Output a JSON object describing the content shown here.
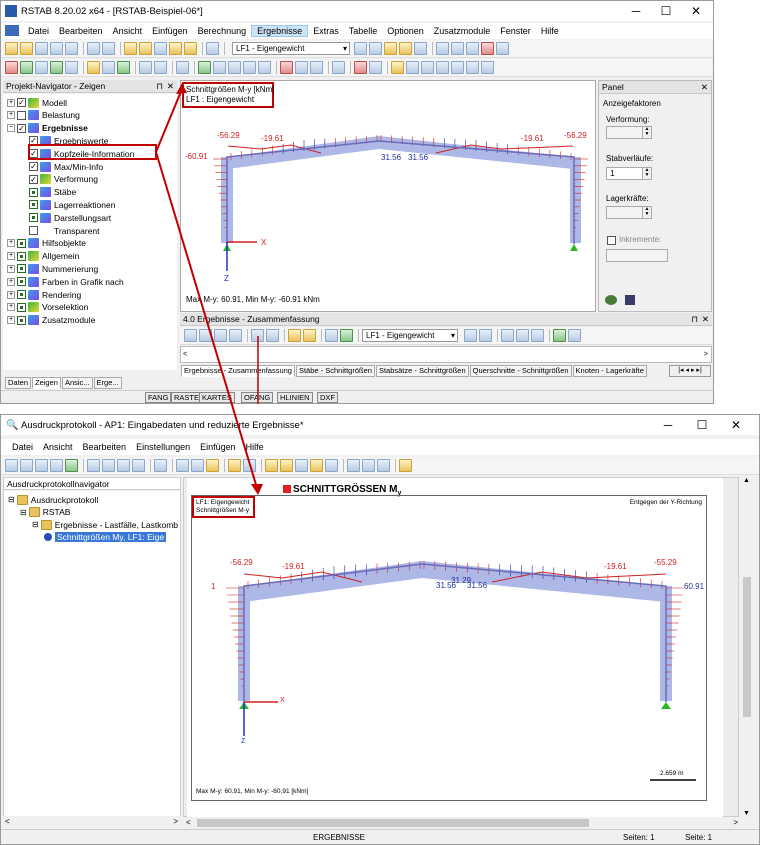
{
  "window1": {
    "title": "RSTAB 8.20.02 x64 - [RSTAB-Beispiel-06*]",
    "menu": [
      "Datei",
      "Bearbeiten",
      "Ansicht",
      "Einfügen",
      "Berechnung",
      "Ergebnisse",
      "Extras",
      "Tabelle",
      "Optionen",
      "Zusatzmodule",
      "Fenster",
      "Hilfe"
    ],
    "loadcase": "LF1 - Eigengewicht",
    "navigator": {
      "title": "Projekt-Navigator - Zeigen",
      "items": [
        "Modell",
        "Belastung",
        "Ergebnisse",
        "Ergebniswerte",
        "Kopfzeile-Information",
        "Max/Min-Info",
        "Verformung",
        "Stäbe",
        "Lagerreaktionen",
        "Darstellungsart",
        "Transparent",
        "Hilfsobjekte",
        "Allgemein",
        "Nummerierung",
        "Farben in Grafik nach",
        "Rendering",
        "Vorselektion",
        "Zusatzmodule"
      ],
      "tabs": [
        "Daten",
        "Zeigen",
        "Ansic...",
        "Erge..."
      ]
    },
    "graphic": {
      "header_line1": "Schnittgrößen M-y [kNm]",
      "header_line2": "LF1 : Eigengewicht",
      "footer": "Max M-y: 60.91, Min M-y: -60.91 kNm",
      "values": {
        "left_top": "-56.29",
        "left_mid": "-19.61",
        "center_l": "31.56",
        "center_r": "31.56",
        "right_mid": "-19.61",
        "right_top": "-56.29",
        "left_col": "-60.91"
      },
      "axis_x": "X",
      "axis_z": "Z"
    },
    "panel": {
      "title": "Panel",
      "section": "Anzeigefaktoren",
      "deform_label": "Verformung:",
      "stab_label": "Stabverläufe:",
      "stab_value": "1",
      "lager_label": "Lagerkräfte:",
      "incr_label": "Inkremente:"
    },
    "results": {
      "title": "4.0 Ergebnisse - Zusammenfassung",
      "loadcase": "LF1 - Eigengewicht",
      "tabs": [
        "Ergebnisse - Zusammenfassung",
        "Stäbe - Schnittgrößen",
        "Stabsätze - Schnittgrößen",
        "Querschnitte - Schnittgrößen",
        "Knoten - Lagerkräfte"
      ]
    },
    "status": [
      "FANG",
      "RASTER",
      "KARTES",
      "OFANG",
      "HLINIEN",
      "DXF"
    ]
  },
  "window2": {
    "title": "Ausdruckprotokoll - AP1: Eingabedaten und reduzierte Ergebnisse*",
    "menu": [
      "Datei",
      "Ansicht",
      "Bearbeiten",
      "Einstellungen",
      "Einfügen",
      "Hilfe"
    ],
    "navigator": {
      "title": "Ausdruckprotokollnavigator",
      "items": [
        "Ausdruckprotokoll",
        "RSTAB",
        "Ergebnisse - Lastfälle, Lastkomb",
        "Schnittgrößen My, LF1: Eige"
      ]
    },
    "page": {
      "heading": "SCHNITTGRÖSSEN M",
      "heading_sub": "y",
      "right_note": "Entgegen der Y-Richtung",
      "header_line1": "LF1: Eigengewicht",
      "header_line2": "Schnittgrößen M-y",
      "footer": "Max M-y: 60.91, Min M-y: -60.91 [kNm]",
      "scale": "2.659 m",
      "values": {
        "left_top": "-56.29",
        "left_mid": "-19.61",
        "center_l": "31.56",
        "center_mid": "31.29",
        "center_r": "31.56",
        "right_mid": "-19.61",
        "right_top": "-55.29",
        "right_col": "60.91",
        "left_col": "1"
      },
      "axis_x": "X",
      "axis_z": "Z"
    },
    "status_center": "ERGEBNISSE",
    "status_pages": "Seiten: 1",
    "status_page": "Seite: 1"
  },
  "colors": {
    "accent_red": "#c00000",
    "diagram_fill": "#aeb8e6",
    "diagram_red": "#d02020"
  }
}
